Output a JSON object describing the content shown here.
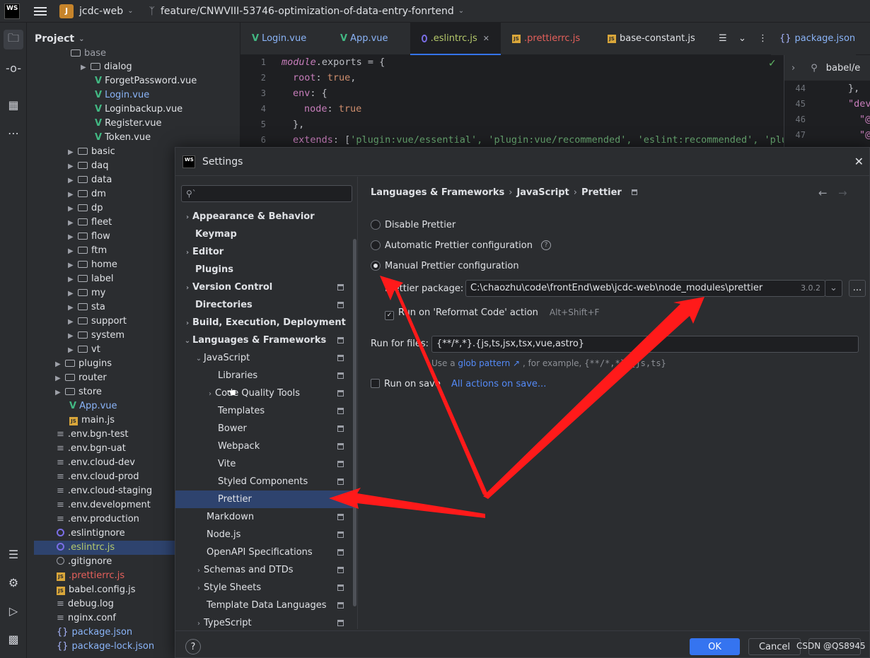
{
  "titlebar": {
    "logo": "WS",
    "project_badge": "J",
    "project_name": "jcdc-web",
    "branch": "feature/CNWVIII-53746-optimization-of-data-entry-fonrtend"
  },
  "project_panel": {
    "title": "Project",
    "rows": [
      {
        "label": "base"
      },
      {
        "label": "dialog"
      },
      {
        "label": "ForgetPassword.vue"
      },
      {
        "label": "Login.vue"
      },
      {
        "label": "Loginbackup.vue"
      },
      {
        "label": "Register.vue"
      },
      {
        "label": "Token.vue"
      },
      {
        "label": "basic"
      },
      {
        "label": "daq"
      },
      {
        "label": "data"
      },
      {
        "label": "dm"
      },
      {
        "label": "dp"
      },
      {
        "label": "fleet"
      },
      {
        "label": "flow"
      },
      {
        "label": "ftm"
      },
      {
        "label": "home"
      },
      {
        "label": "label"
      },
      {
        "label": "my"
      },
      {
        "label": "sta"
      },
      {
        "label": "support"
      },
      {
        "label": "system"
      },
      {
        "label": "vt"
      },
      {
        "label": "plugins"
      },
      {
        "label": "router"
      },
      {
        "label": "store"
      },
      {
        "label": "App.vue"
      },
      {
        "label": "main.js"
      },
      {
        "label": ".env.bgn-test"
      },
      {
        "label": ".env.bgn-uat"
      },
      {
        "label": ".env.cloud-dev"
      },
      {
        "label": ".env.cloud-prod"
      },
      {
        "label": ".env.cloud-staging"
      },
      {
        "label": ".env.development"
      },
      {
        "label": ".env.production"
      },
      {
        "label": ".eslintignore"
      },
      {
        "label": ".eslintrc.js"
      },
      {
        "label": ".gitignore"
      },
      {
        "label": ".prettierrc.js"
      },
      {
        "label": "babel.config.js"
      },
      {
        "label": "debug.log"
      },
      {
        "label": "nginx.conf"
      },
      {
        "label": "package.json"
      },
      {
        "label": "package-lock.json"
      }
    ]
  },
  "tabs": [
    {
      "label": "Login.vue"
    },
    {
      "label": "App.vue"
    },
    {
      "label": ".eslintrc.js"
    },
    {
      "label": ".prettierrc.js"
    },
    {
      "label": "base-constant.js"
    },
    {
      "label": "package.json"
    }
  ],
  "editor": {
    "line_numbers": [
      "1",
      "2",
      "3",
      "4",
      "5",
      "6"
    ],
    "lines": [
      {
        "a": "module",
        "b": ".exports = {"
      },
      {
        "a": "root",
        "b": ": ",
        "c": "true",
        "d": ","
      },
      {
        "a": "env",
        "b": ": {"
      },
      {
        "a": "node",
        "b": ": ",
        "c": "true"
      },
      {
        "a": "},"
      },
      {
        "a": "extends",
        "b": ": [",
        "c": "'plugin:vue/essential', 'plugin:vue/recommended', 'eslint:recommended', 'plug"
      }
    ]
  },
  "editor2": {
    "search": "babel/e",
    "line_numbers": [
      "44",
      "45",
      "46",
      "47"
    ],
    "lines": [
      "},",
      "\"dev",
      "\"@",
      "\"@"
    ]
  },
  "dialog": {
    "title": "Settings",
    "nav": [
      {
        "label": "Appearance & Behavior"
      },
      {
        "label": "Keymap"
      },
      {
        "label": "Editor"
      },
      {
        "label": "Plugins"
      },
      {
        "label": "Version Control"
      },
      {
        "label": "Directories"
      },
      {
        "label": "Build, Execution, Deployment"
      },
      {
        "label": "Languages & Frameworks"
      },
      {
        "label": "JavaScript"
      },
      {
        "label": "Libraries"
      },
      {
        "label": "Code Quality Tools"
      },
      {
        "label": "Templates"
      },
      {
        "label": "Bower"
      },
      {
        "label": "Webpack"
      },
      {
        "label": "Vite"
      },
      {
        "label": "Styled Components"
      },
      {
        "label": "Prettier"
      },
      {
        "label": "Markdown"
      },
      {
        "label": "Node.js"
      },
      {
        "label": "OpenAPI Specifications"
      },
      {
        "label": "Schemas and DTDs"
      },
      {
        "label": "Style Sheets"
      },
      {
        "label": "Template Data Languages"
      },
      {
        "label": "TypeScript"
      }
    ],
    "breadcrumb": [
      "Languages & Frameworks",
      "JavaScript",
      "Prettier"
    ],
    "options": {
      "disable": "Disable Prettier",
      "automatic": "Automatic Prettier configuration",
      "manual": "Manual Prettier configuration",
      "selected": "manual"
    },
    "package_label": "Prettier package:",
    "package_path": "C:\\chaozhu\\code\\frontEnd\\web\\jcdc-web\\node_modules\\prettier",
    "package_version": "3.0.2",
    "browse": "...",
    "reformat_label": "Run on 'Reformat Code' action",
    "reformat_shortcut": "Alt+Shift+F",
    "reformat_checked": true,
    "run_for_files_label": "Run for files:",
    "run_for_files_value": "{**/*,*}.{js,ts,jsx,tsx,vue,astro}",
    "hint_prefix": "Use a",
    "hint_link": "glob pattern ↗",
    "hint_suffix": ", for example,",
    "hint_example": "{**/*,*}.{js,ts}",
    "run_on_save_label": "Run on save",
    "run_on_save_checked": false,
    "all_actions": "All actions on save...",
    "ok": "OK",
    "cancel": "Cancel"
  },
  "watermark": "CSDN @QS8945",
  "colors": {
    "accent": "#3574f0",
    "arrow": "#ff1a1a",
    "selection": "#2e436e"
  }
}
